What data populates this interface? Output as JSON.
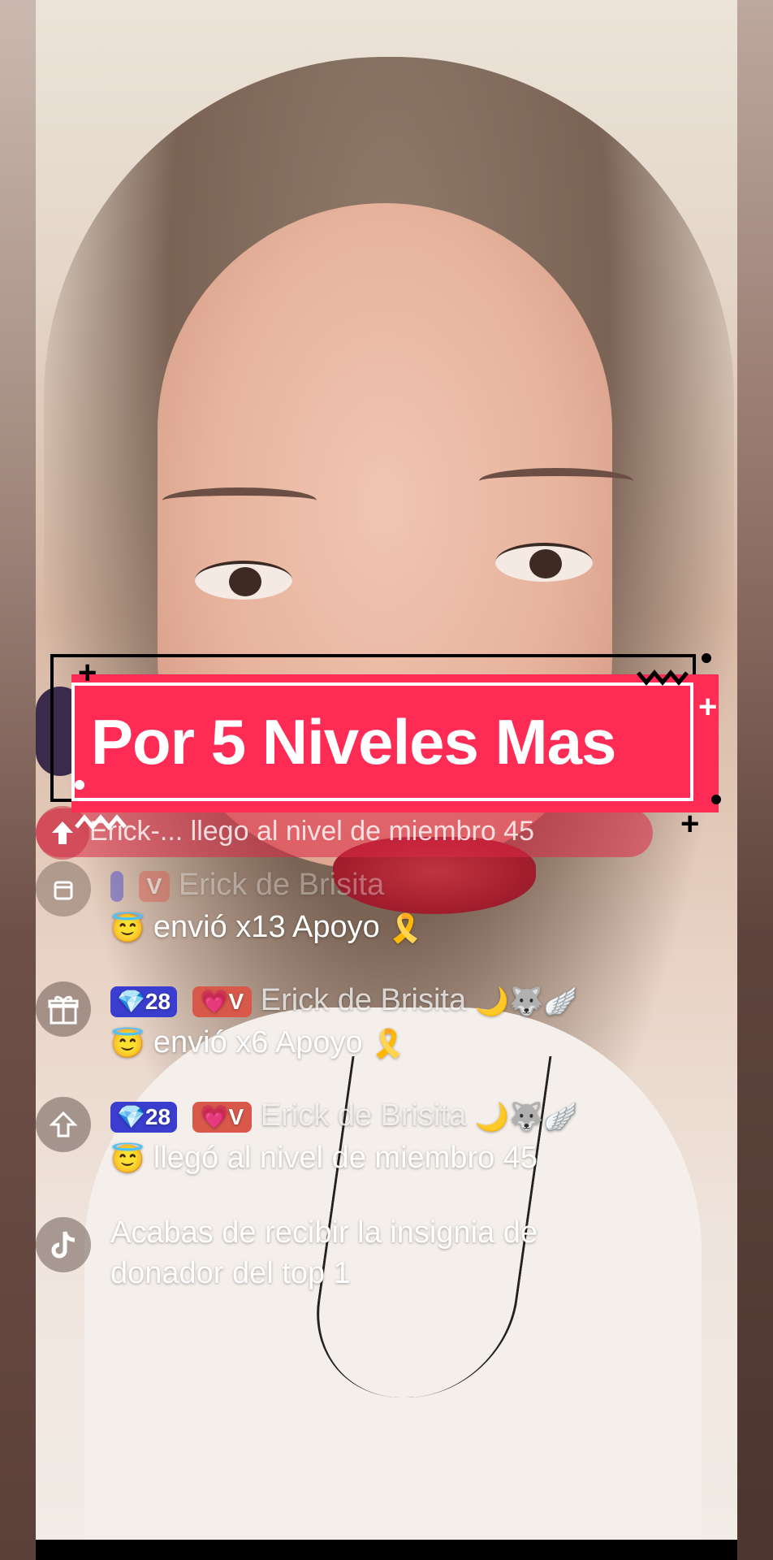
{
  "caption": {
    "text": "Por 5 Niveles Mas"
  },
  "join_notice": {
    "text": "Erick-...  llego al nivel de miembro 45"
  },
  "chat": [
    {
      "level": "",
      "badge": "V",
      "user": "Erick de Brisita",
      "message": "envió x13 Apoyo",
      "icon": "rocket-icon"
    },
    {
      "level": "28",
      "badge": "V",
      "user": "Erick de Brisita",
      "message": "envió x6 Apoyo",
      "icon": "gift-icon"
    },
    {
      "level": "28",
      "badge": "V",
      "user": "Erick de Brisita",
      "message": "llegó al nivel de miembro 45",
      "icon": "level-up-icon"
    },
    {
      "message": "Acabas de recibir la insignia de",
      "message2": "donador del top 1",
      "icon": "tiktok-icon"
    }
  ],
  "colors": {
    "caption_bg": "#fe2b55",
    "level_badge": "#3b3dcf",
    "fan_badge": "#d8584a"
  }
}
